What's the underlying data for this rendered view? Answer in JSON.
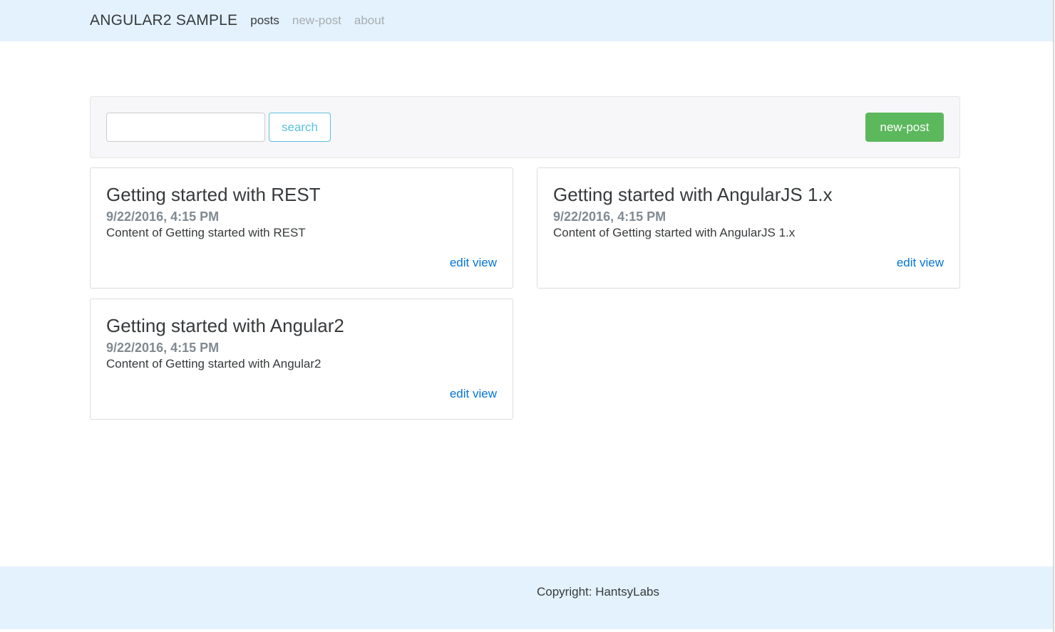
{
  "navbar": {
    "brand": "ANGULAR2 SAMPLE",
    "links": [
      {
        "label": "posts",
        "active": true
      },
      {
        "label": "new-post",
        "active": false
      },
      {
        "label": "about",
        "active": false
      }
    ]
  },
  "toolbar": {
    "search_value": "",
    "search_label": "search",
    "new_post_label": "new-post"
  },
  "posts": [
    {
      "title": "Getting started with REST",
      "date": "9/22/2016, 4:15 PM",
      "content": "Content of Getting started with REST",
      "edit_label": "edit",
      "view_label": "view"
    },
    {
      "title": "Getting started with AngularJS 1.x",
      "date": "9/22/2016, 4:15 PM",
      "content": "Content of Getting started with AngularJS 1.x",
      "edit_label": "edit",
      "view_label": "view"
    },
    {
      "title": "Getting started with Angular2",
      "date": "9/22/2016, 4:15 PM",
      "content": "Content of Getting started with Angular2",
      "edit_label": "edit",
      "view_label": "view"
    }
  ],
  "footer": {
    "copyright": "Copyright: HantsyLabs"
  },
  "colors": {
    "navbar_bg": "#e3f2fd",
    "info": "#5bc0de",
    "success": "#5cb85c",
    "link": "#0275d8"
  }
}
